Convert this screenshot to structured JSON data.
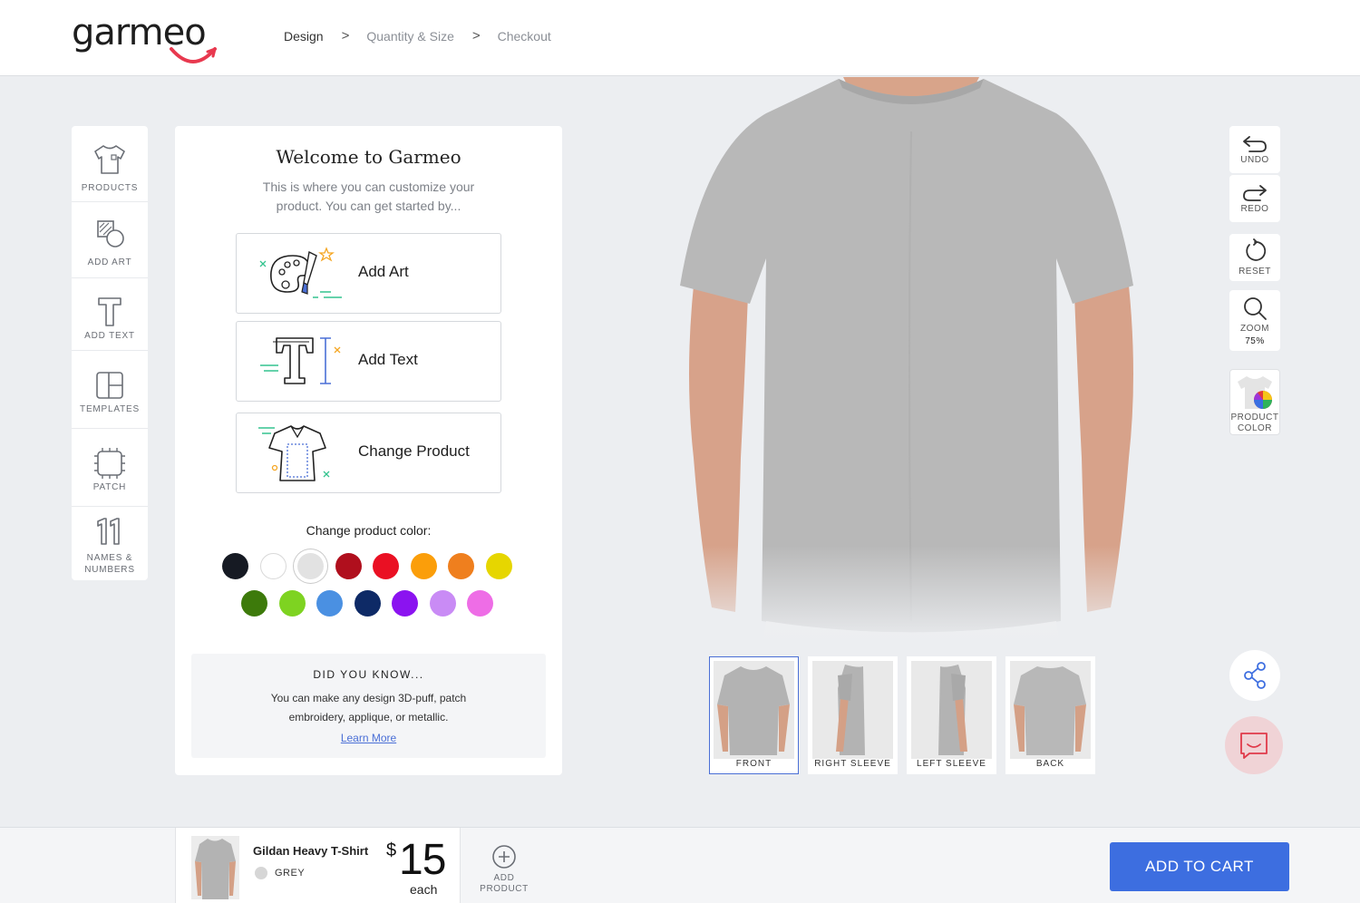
{
  "header": {
    "logo_text": "garmeo",
    "breadcrumbs": [
      "Design",
      "Quantity & Size",
      "Checkout"
    ],
    "breadcrumb_sep": ">"
  },
  "rail": {
    "items": [
      {
        "label": "PRODUCTS",
        "icon": "shirt-icon"
      },
      {
        "label": "ADD ART",
        "icon": "art-icon"
      },
      {
        "label": "ADD TEXT",
        "icon": "text-icon"
      },
      {
        "label": "TEMPLATES",
        "icon": "templates-icon"
      },
      {
        "label": "PATCH",
        "icon": "patch-icon"
      },
      {
        "label": "NAMES &",
        "label2": "NUMBERS",
        "icon": "numbers-icon"
      }
    ]
  },
  "panel": {
    "title": "Welcome to Garmeo",
    "subtitle": "This is where you can customize your product. You can get started by...",
    "actions": [
      {
        "label": "Add Art",
        "icon": "palette-icon"
      },
      {
        "label": "Add Text",
        "icon": "text-cursor-icon"
      },
      {
        "label": "Change Product",
        "icon": "shirt-outline-icon"
      }
    ],
    "color_title": "Change product color:",
    "colors": [
      "#161a23",
      "#ffffff",
      "#e2e2e2",
      "#b00f1d",
      "#ea1023",
      "#fb9e0a",
      "#ef7f1e",
      "#e6d600",
      "#3d7a0b",
      "#7ed321",
      "#4a90e2",
      "#0e2a66",
      "#8b13f0",
      "#c98bf5",
      "#ee6de6"
    ],
    "selected_color": "#e2e2e2",
    "tip": {
      "title": "DID YOU KNOW...",
      "body": "You can make any design 3D-puff, patch embroidery, applique, or metallic.",
      "link": "Learn More"
    }
  },
  "views": [
    {
      "label": "FRONT",
      "selected": true
    },
    {
      "label": "RIGHT SLEEVE",
      "selected": false
    },
    {
      "label": "LEFT SLEEVE",
      "selected": false
    },
    {
      "label": "BACK",
      "selected": false
    }
  ],
  "tools": {
    "undo": "UNDO",
    "redo": "REDO",
    "reset": "RESET",
    "zoom": "ZOOM",
    "zoom_level": "75%",
    "product_color_1": "PRODUCT",
    "product_color_2": "COLOR"
  },
  "footer": {
    "product_name": "Gildan Heavy T-Shirt",
    "product_color": "GREY",
    "currency": "$",
    "price": "15",
    "price_unit": "each",
    "add_product_1": "ADD",
    "add_product_2": "PRODUCT",
    "cart_label": "ADD TO CART"
  },
  "theme": {
    "accent": "#3d6ee0",
    "logo_smile": "#e8394f"
  }
}
